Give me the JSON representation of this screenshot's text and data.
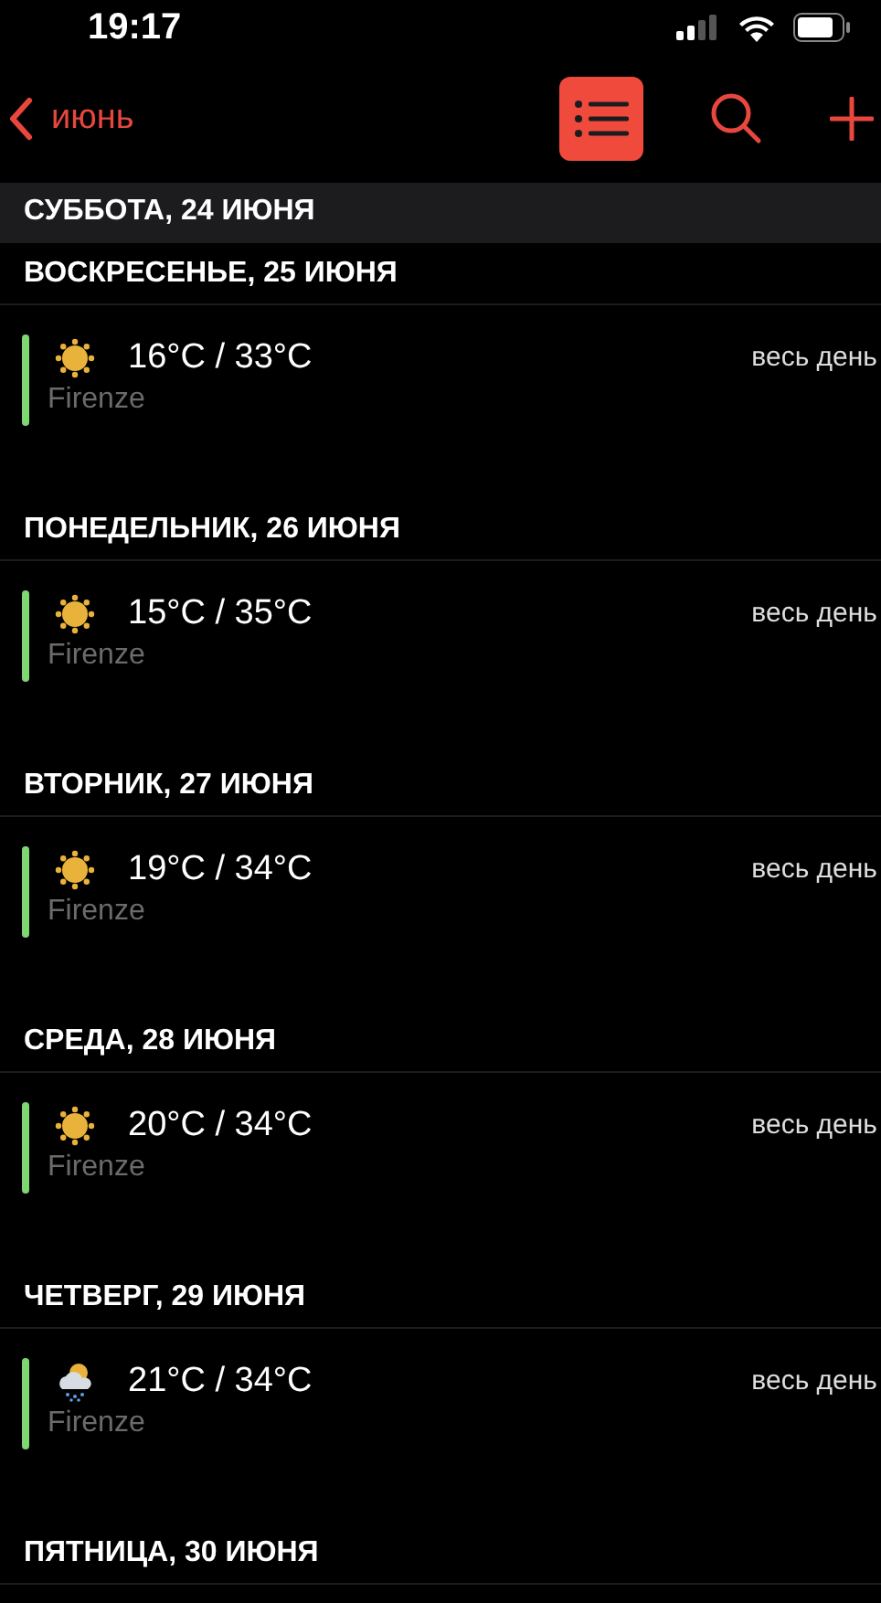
{
  "status_bar": {
    "time": "19:17"
  },
  "nav": {
    "back_label": "июнь",
    "list_view": {
      "selected": true
    }
  },
  "days": [
    {
      "title": "СУББОТА, 24 ИЮНЯ",
      "sticky": true
    },
    {
      "title": "ВОСКРЕСЕНЬЕ, 25 ИЮНЯ",
      "sticky": false,
      "events": [
        {
          "kind": "sun",
          "title": "16°C / 33°C",
          "location": "Firenze",
          "time": "весь день",
          "color": "#7fd673"
        }
      ]
    },
    {
      "title": "ПОНЕДЕЛЬНИК, 26 ИЮНЯ",
      "sticky": false,
      "events": [
        {
          "kind": "sun",
          "title": "15°C / 35°C",
          "location": "Firenze",
          "time": "весь день",
          "color": "#7fd673"
        }
      ]
    },
    {
      "title": "ВТОРНИК, 27 ИЮНЯ",
      "sticky": false,
      "events": [
        {
          "kind": "sun",
          "title": "19°C / 34°C",
          "location": "Firenze",
          "time": "весь день",
          "color": "#7fd673"
        }
      ]
    },
    {
      "title": "СРЕДА, 28 ИЮНЯ",
      "sticky": false,
      "events": [
        {
          "kind": "sun",
          "title": "20°C / 34°C",
          "location": "Firenze",
          "time": "весь день",
          "color": "#7fd673"
        }
      ]
    },
    {
      "title": "ЧЕТВЕРГ, 29 ИЮНЯ",
      "sticky": false,
      "events": [
        {
          "kind": "rain",
          "title": "21°C / 34°C",
          "location": "Firenze",
          "time": "весь день",
          "color": "#7fd673"
        }
      ]
    },
    {
      "title": "ПЯТНИЦА, 30 ИЮНЯ",
      "sticky": false
    }
  ]
}
